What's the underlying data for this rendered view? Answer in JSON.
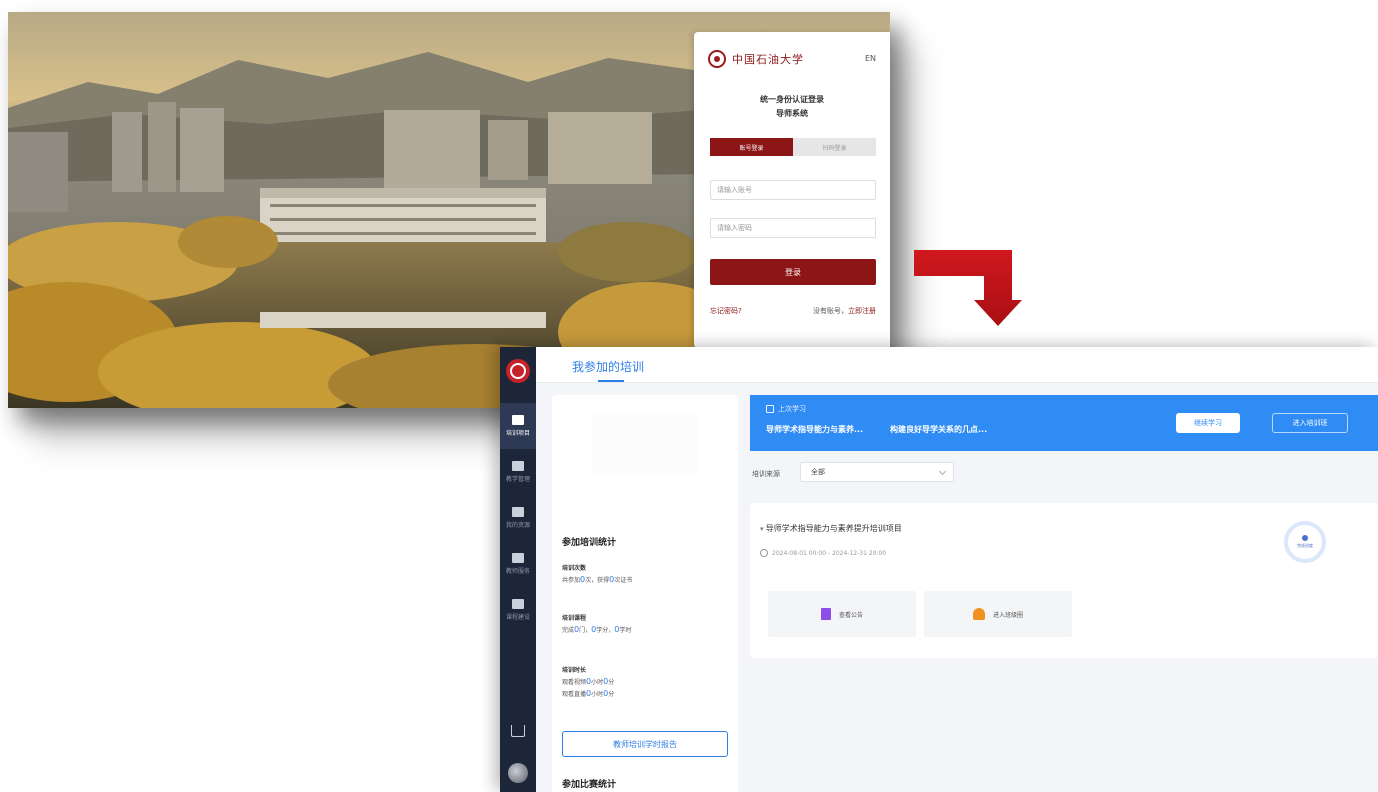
{
  "login": {
    "logo_text": "中国石油大学",
    "lang": "EN",
    "title": "统一身份认证登录",
    "subtitle": "导师系统",
    "tabs": [
      "账号登录",
      "扫码登录"
    ],
    "username_placeholder": "请输入账号",
    "password_placeholder": "请输入密码",
    "login_button": "登录",
    "forgot": "忘记密码?",
    "register_prefix": "没有账号，",
    "register_link": "立即注册"
  },
  "lms": {
    "top_tab": "我参加的培训",
    "sidebar": [
      {
        "label": "培训项目"
      },
      {
        "label": "教学管理"
      },
      {
        "label": "我的资源"
      },
      {
        "label": "教师服务"
      },
      {
        "label": "课程建设"
      }
    ],
    "stats": {
      "title": "参加培训统计",
      "count_label": "培训次数",
      "count_prefix": "共参加",
      "count_value": "0",
      "count_mid": "次，获得",
      "cert_value": "0",
      "count_suffix": "次证书",
      "course_label": "培训课程",
      "course_prefix": "完成",
      "course_value": "0",
      "course_mid1": "门，",
      "credit_value": "0",
      "course_mid2": "学分，",
      "hours_value": "0",
      "course_suffix": "学时",
      "duration_label": "培训时长",
      "video_prefix": "观看视频",
      "video_h": "0",
      "video_mid": "小时",
      "video_m": "0",
      "video_suffix": "分",
      "live_prefix": "观看直播",
      "live_h": "0",
      "live_mid": "小时",
      "live_m": "0",
      "live_suffix": "分",
      "report_button": "教师培训学时报告",
      "contest_title": "参加比赛统计"
    },
    "banner": {
      "label": "上次学习",
      "course1": "导师学术指导能力与素养...",
      "course2": "构建良好导学关系的几点...",
      "continue_button": "继续学习",
      "enter_button": "进入培训班"
    },
    "filter": {
      "label": "培训来源",
      "value": "全部"
    },
    "course": {
      "title": "导师学术指导能力与素养提升培训项目",
      "date": "2024-08-01 00:00 - 2024-12-31 20:00",
      "progress_label": "完成进度",
      "tiles": [
        "查看公告",
        "进入班级圈"
      ]
    }
  },
  "colors": {
    "brand_red": "#8c1515",
    "accent_blue": "#2f8cf4",
    "arrow_red": "#c4161c",
    "sidebar_bg": "#1d2538"
  }
}
